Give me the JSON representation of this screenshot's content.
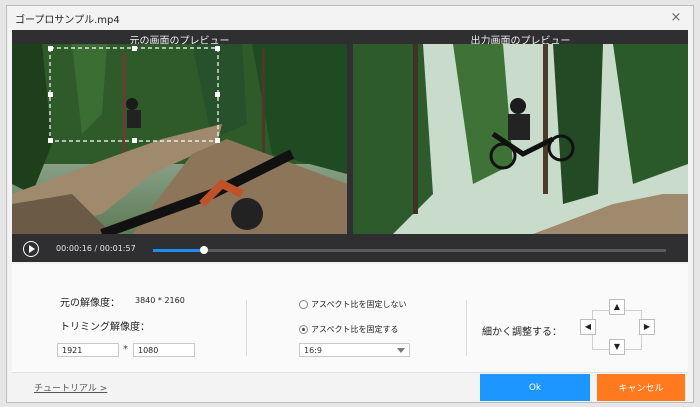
{
  "window": {
    "title": "ゴープロサンプル.mp4",
    "close_glyph": "×"
  },
  "preview": {
    "left_label": "元の画面のプレビュー",
    "right_label": "出力画面のプレビュー"
  },
  "player": {
    "current_time": "00:00:16",
    "separator": "/",
    "total_time": "00:01:57",
    "progress": 0.1,
    "accent": "#1e8cf0"
  },
  "settings": {
    "original_res_label": "元の解像度：",
    "original_res_value": "3840 * 2160",
    "trim_res_label": "トリミング解像度：",
    "width_value": "1921",
    "mult": "*",
    "height_value": "1080",
    "aspect_free_label": "アスペクト比を固定しない",
    "aspect_fixed_label": "アスペクト比を固定する",
    "aspect_value": "16:9",
    "fine_tune_label": "細かく調整する："
  },
  "footer": {
    "tutorial_label": "チュートリアル >",
    "ok_label": "Ok",
    "cancel_label": "キャンセル",
    "ok_color": "#1e96ff",
    "cancel_color": "#ff7a1f"
  }
}
